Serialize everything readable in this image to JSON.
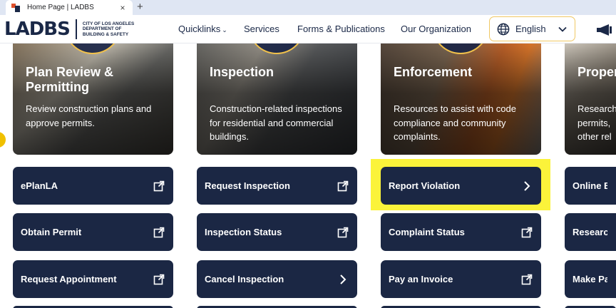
{
  "browser": {
    "tab_title": "Home Page | LADBS",
    "close_glyph": "×",
    "new_tab_glyph": "+"
  },
  "header": {
    "logo_text": "LADBS",
    "logo_sub_lines": [
      "CITY OF LOS ANGELES",
      "DEPARTMENT OF",
      "BUILDING & SAFETY"
    ],
    "nav": {
      "quicklinks": "Quicklinks",
      "quicklinks_chev": "⌄",
      "services": "Services",
      "forms": "Forms & Publications",
      "org": "Our Organization"
    },
    "language": "English"
  },
  "colors": {
    "navy": "#1b2744",
    "accent_orange": "#e0502a",
    "highlight_yellow": "#fbf33a",
    "ring_gold": "#f1c14b"
  },
  "cards": [
    {
      "title": "Plan Review & Permitting",
      "desc": "Review construction plans and approve permits."
    },
    {
      "title": "Inspection",
      "desc": "Construction-related inspections for residential and commercial buildings."
    },
    {
      "title": "Enforcement",
      "desc": "Resources to assist with code compliance and community complaints."
    },
    {
      "title": "Proper",
      "desc": "Research permits, other rel"
    }
  ],
  "buttons": {
    "col1": [
      {
        "label": "ePlanLA",
        "icon": "external-link-icon"
      },
      {
        "label": "Obtain Permit",
        "icon": "external-link-icon"
      },
      {
        "label": "Request Appointment",
        "icon": "external-link-icon"
      }
    ],
    "col2": [
      {
        "label": "Request Inspection",
        "icon": "external-link-icon"
      },
      {
        "label": "Inspection Status",
        "icon": "external-link-icon"
      },
      {
        "label": "Cancel Inspection",
        "icon": "chevron-right-icon"
      }
    ],
    "col3": [
      {
        "label": "Report Violation",
        "icon": "chevron-right-icon"
      },
      {
        "label": "Complaint Status",
        "icon": "external-link-icon"
      },
      {
        "label": "Pay an Invoice",
        "icon": "external-link-icon"
      }
    ],
    "col4": [
      {
        "label": "Online Bu",
        "icon": "none"
      },
      {
        "label": "Research",
        "icon": "none"
      },
      {
        "label": "Make Pay",
        "icon": "none"
      }
    ]
  }
}
